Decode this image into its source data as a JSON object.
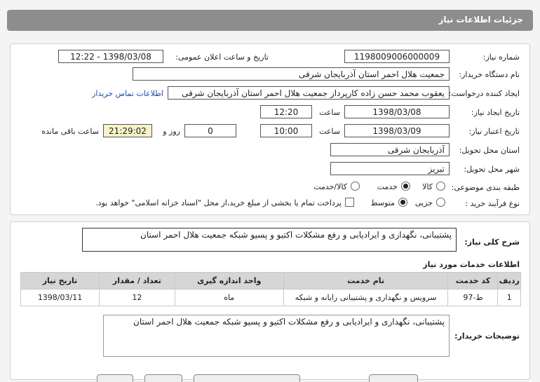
{
  "header": {
    "title": "جزئیات اطلاعات نیاز"
  },
  "form": {
    "need_number_label": "شماره نیاز:",
    "need_number": "1198009006000009",
    "announce_label": "تاریخ و ساعت اعلان عمومی:",
    "announce_value": "1398/03/08 - 12:22",
    "buyer_label": "نام دستگاه خریدار:",
    "buyer_value": "جمعیت هلال احمر استان آذربایجان شرقی",
    "requester_label": "ایجاد کننده درخواست:",
    "requester_value": "یعقوب محمد حسن زاده کارپرداز جمعیت هلال احمر استان آذربایجان شرقی",
    "contact_link": "اطلاعات تماس خریدار",
    "created_label": "تاریخ ایجاد نیاز:",
    "created_date": "1398/03/08",
    "created_time_label": "ساعت",
    "created_time": "12:20",
    "valid_label": "تاریخ اعتبار نیاز:",
    "valid_date": "1398/03/09",
    "valid_time_label": "ساعت",
    "valid_time": "10:00",
    "days_value": "0",
    "days_label": "روز و",
    "remaining_time": "21:29:02",
    "remaining_label": "ساعت باقی مانده",
    "province_label": "استان محل تحویل:",
    "province_value": "آذربایجان شرقی",
    "city_label": "شهر محل تحویل:",
    "city_value": "تبریز",
    "category_label": "طبقه بندی موضوعی:",
    "category_options": [
      "کالا",
      "خدمت",
      "کالا/خدمت"
    ],
    "process_label": "نوع فرآیند خرید :",
    "process_options": [
      "جزیی",
      "متوسط"
    ],
    "payment_note": "پرداخت تمام یا بخشی از مبلغ خرید،از محل \"اسناد خزانه اسلامی\" خواهد بود."
  },
  "summary": {
    "label": "شرح کلی نیاز:",
    "value": "پشتیبانی، نگهداری و ایرادیابی و رفع مشکلات  اکتیو و پسیو شبکه جمعیت هلال احمر استان"
  },
  "services": {
    "title": "اطلاعات خدمات مورد نیاز",
    "columns": [
      "ردیف",
      "کد خدمت",
      "نام خدمت",
      "واحد اندازه گیری",
      "تعداد / مقدار",
      "تاریخ نیاز"
    ],
    "rows": [
      [
        "1",
        "ط-97",
        "سرویس و نگهداری و پشتیبانی رایانه و شبکه",
        "ماه",
        "12",
        "1398/03/11"
      ]
    ]
  },
  "buyer_notes": {
    "label": "توضیحات خریدار:",
    "value": "پشتیبانی، نگهداری و ایرادیابی و رفع مشکلات  اکتیو و پسیو شبکه جمعیت هلال احمر استان"
  },
  "colors": {
    "header_bg": "#8d8d8d",
    "link": "#1a4fa8",
    "remaining_bg": "#f7f3c8"
  }
}
